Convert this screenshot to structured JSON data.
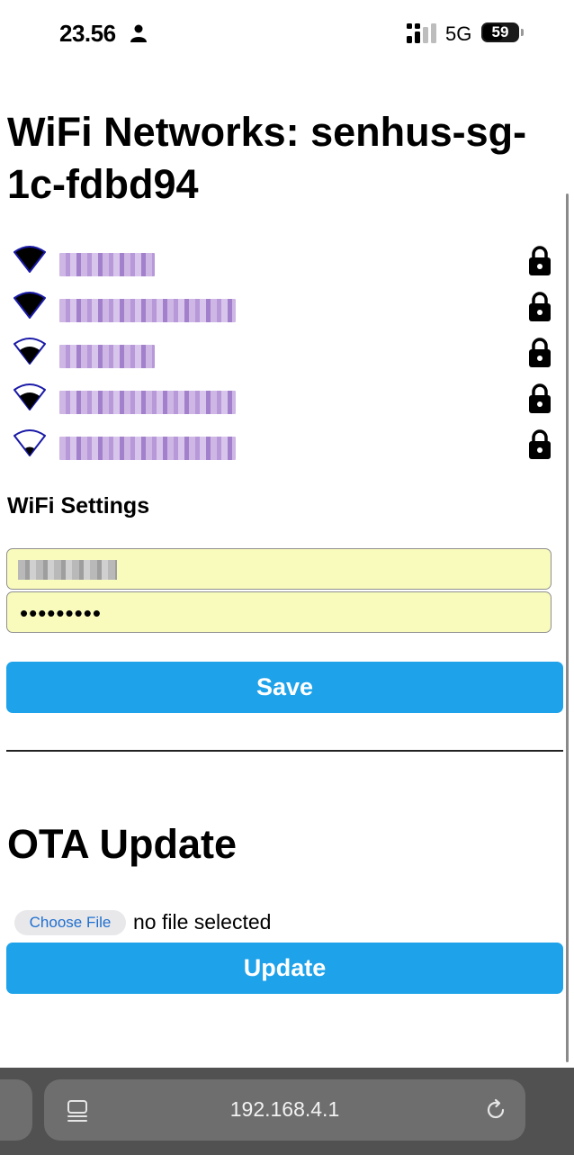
{
  "status_bar": {
    "time": "23.56",
    "network_type": "5G",
    "battery_level": "59",
    "battery_fraction": 0.59,
    "icons": [
      "person-icon",
      "cellular-signal-icon",
      "battery-icon"
    ]
  },
  "page": {
    "title": "WiFi Networks: senhus-sg-1c-fdbd94"
  },
  "networks": {
    "items": [
      {
        "signal_icon": "wifi-strong-icon",
        "secured": true,
        "lock_icon": "lock-icon"
      },
      {
        "signal_icon": "wifi-strong-icon",
        "secured": true,
        "lock_icon": "lock-icon"
      },
      {
        "signal_icon": "wifi-medium-icon",
        "secured": true,
        "lock_icon": "lock-icon"
      },
      {
        "signal_icon": "wifi-medium-icon",
        "secured": true,
        "lock_icon": "lock-icon"
      },
      {
        "signal_icon": "wifi-weak-icon",
        "secured": true,
        "lock_icon": "lock-icon"
      }
    ]
  },
  "wifi_settings": {
    "heading": "WiFi Settings",
    "password_value": "•••••••••",
    "save_label": "Save"
  },
  "ota": {
    "heading": "OTA Update",
    "choose_file_label": "Choose File",
    "file_status": "no file selected",
    "update_label": "Update"
  },
  "browser": {
    "address": "192.168.4.1",
    "icons": [
      "page-menu-icon",
      "reload-icon"
    ]
  },
  "colors": {
    "primary_button": "#1ea2ea",
    "input_background": "#f9fbbd",
    "wifi_icon_outline": "#1a1aa8",
    "toolbar_background": "#515151"
  }
}
